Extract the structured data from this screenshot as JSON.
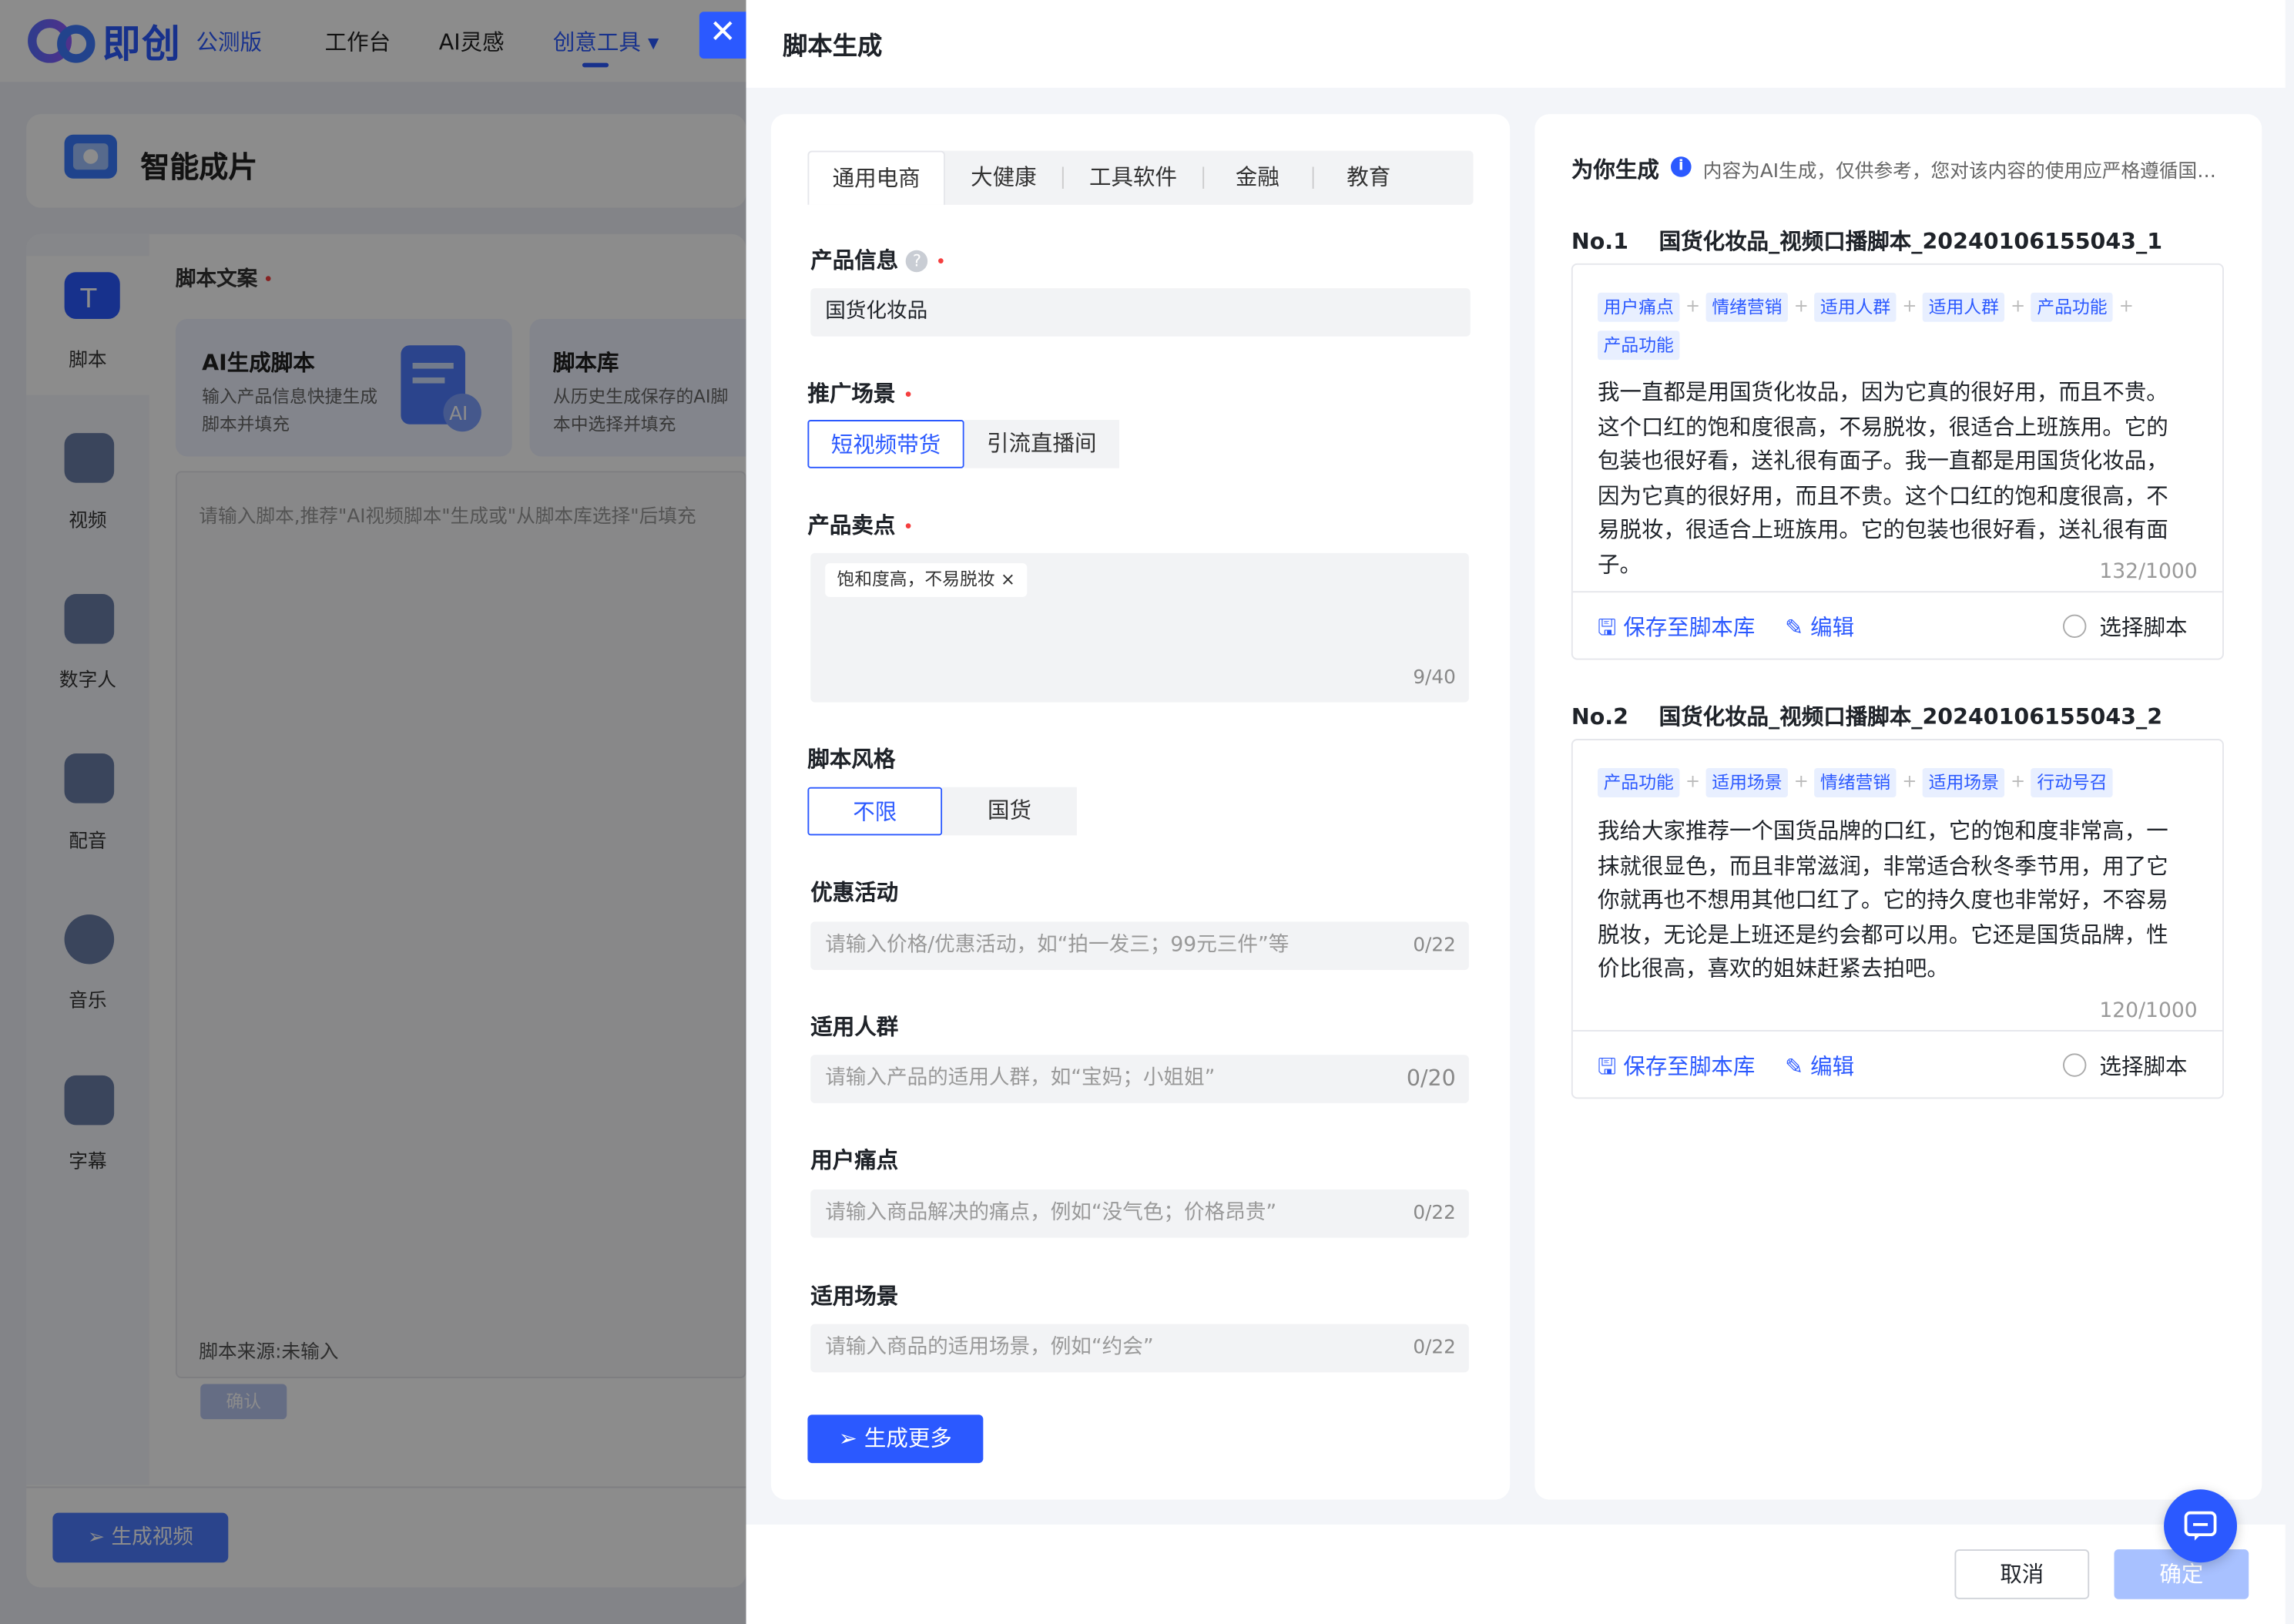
{
  "app": {
    "logo_text": "即创",
    "beta": "公测版",
    "nav": [
      "工作台",
      "AI灵感",
      "创意工具 ▾"
    ]
  },
  "background": {
    "header_title": "智能成片",
    "sidebar": [
      "脚本",
      "视频",
      "数字人",
      "配音",
      "音乐",
      "字幕"
    ],
    "section_title": "脚本文案",
    "feature_cards": [
      {
        "title": "AI生成脚本",
        "desc": "输入产品信息快捷生成脚本并填充"
      },
      {
        "title": "脚本库",
        "desc": "从历史生成保存的AI脚本中选择并填充"
      }
    ],
    "textarea_placeholder": "请输入脚本,推荐\"AI视频脚本\"生成或\"从脚本库选择\"后填充",
    "source": "脚本来源:未输入",
    "confirm": "确认",
    "generate_video": "生成视频"
  },
  "drawer": {
    "title": "脚本生成",
    "tabs": [
      "通用电商",
      "大健康",
      "工具软件",
      "金融",
      "教育"
    ],
    "product_info": {
      "label": "产品信息",
      "value": "国货化妆品"
    },
    "scene": {
      "label": "推广场景",
      "options": [
        "短视频带货",
        "引流直播间"
      ]
    },
    "selling_points": {
      "label": "产品卖点",
      "chip": "饱和度高，不易脱妆",
      "count": "9/40"
    },
    "style": {
      "label": "脚本风格",
      "options": [
        "不限",
        "国货"
      ]
    },
    "promotion": {
      "label": "优惠活动",
      "placeholder": "请输入价格/优惠活动，如“拍一发三；99元三件”等",
      "count": "0/22"
    },
    "audience": {
      "label": "适用人群",
      "placeholder": "请输入产品的适用人群，如“宝妈；小姐姐”",
      "count": "0/20"
    },
    "pain": {
      "label": "用户痛点",
      "placeholder": "请输入商品解决的痛点，例如“没气色；价格昂贵”",
      "count": "0/22"
    },
    "usage_scene": {
      "label": "适用场景",
      "placeholder": "请输入商品的适用场景，例如“约会”",
      "count": "0/22"
    },
    "generate_more": "生成更多",
    "results": {
      "title": "为你生成",
      "note": "内容为AI生成，仅供参考，您对该内容的使用应严格遵循国家相关法律法规",
      "items": [
        {
          "no": "No.1",
          "name": "国货化妆品_视频口播脚本_20240106155043_1",
          "tags": [
            "用户痛点",
            "情绪营销",
            "适用人群",
            "适用人群",
            "产品功能",
            "产品功能"
          ],
          "text": "我一直都是用国货化妆品，因为它真的很好用，而且不贵。这个口红的饱和度很高，不易脱妆，很适合上班族用。它的包装也很好看，送礼很有面子。我一直都是用国货化妆品，因为它真的很好用，而且不贵。这个口红的饱和度很高，不易脱妆，很适合上班族用。它的包装也很好看，送礼很有面子。",
          "count": "132/1000"
        },
        {
          "no": "No.2",
          "name": "国货化妆品_视频口播脚本_20240106155043_2",
          "tags": [
            "产品功能",
            "适用场景",
            "情绪营销",
            "适用场景",
            "行动号召"
          ],
          "text": "我给大家推荐一个国货品牌的口红，它的饱和度非常高，一抹就很显色，而且非常滋润，非常适合秋冬季节用，用了它你就再也不想用其他口红了。它的持久度也非常好，不容易脱妆，无论是上班还是约会都可以用。它还是国货品牌，性价比很高，喜欢的姐妹赶紧去拍吧。",
          "count": "120/1000"
        }
      ],
      "save": "保存至脚本库",
      "edit": "编辑",
      "select": "选择脚本"
    },
    "cancel": "取消",
    "ok": "确定"
  },
  "colors": {
    "accent": "#2b59ff",
    "required": "#f53f3f",
    "tag_bg": "#e8efff"
  }
}
